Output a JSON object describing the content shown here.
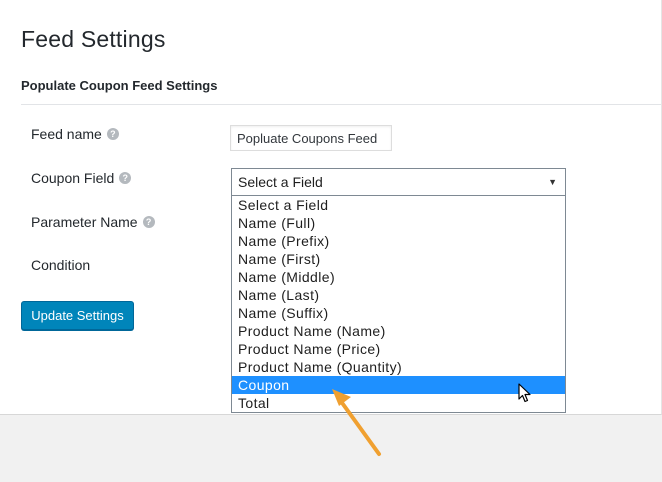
{
  "page": {
    "title": "Feed Settings"
  },
  "section": {
    "title": "Populate Coupon Feed Settings"
  },
  "form": {
    "feed_name_label": "Feed name",
    "feed_name_value": "Popluate Coupons Feed",
    "coupon_field_label": "Coupon Field",
    "coupon_field_selected": "Select a Field",
    "parameter_name_label": "Parameter Name",
    "condition_label": "Condition",
    "help_glyph": "?",
    "select_arrow": "▼"
  },
  "dropdown": {
    "options": [
      "Select a Field",
      "Name (Full)",
      "Name (Prefix)",
      "Name (First)",
      "Name (Middle)",
      "Name (Last)",
      "Name (Suffix)",
      "Product Name (Name)",
      "Product Name (Price)",
      "Product Name (Quantity)",
      "Coupon",
      "Total"
    ],
    "highlighted": "Coupon"
  },
  "button": {
    "update_label": "Update Settings"
  },
  "colors": {
    "primary_button": "#0085ba",
    "highlight": "#1e90ff",
    "annotation_arrow": "#f0a030"
  },
  "icons": {
    "help": "help-circle-icon",
    "cursor": "mouse-pointer-icon",
    "annotation": "annotation-arrow-icon"
  }
}
